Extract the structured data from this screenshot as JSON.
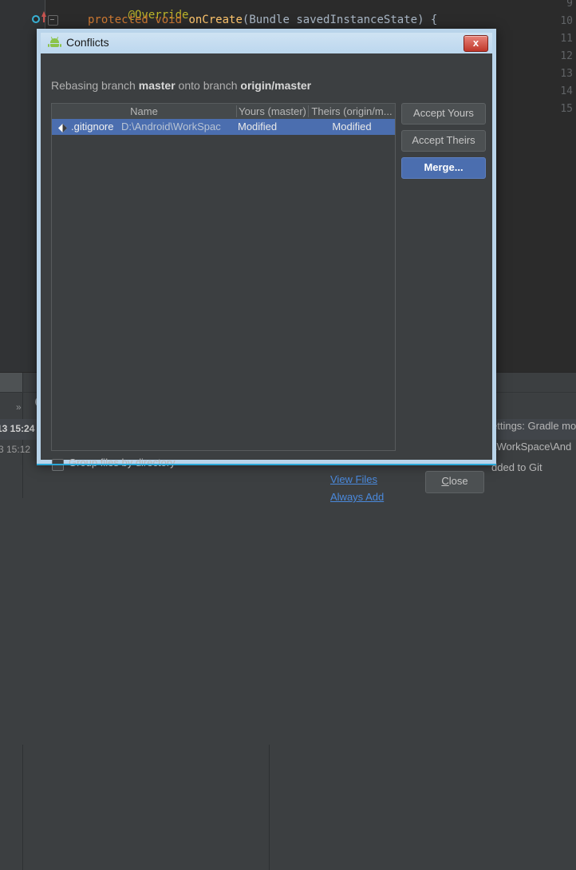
{
  "background": {
    "editor": {
      "line_numbers": [
        "9",
        "10",
        "11",
        "12",
        "13",
        "14",
        "15"
      ],
      "code": {
        "line9_annotation": "@Override",
        "line10_kw1": "protected",
        "line10_kw2": "void",
        "line10_fn": "onCreate",
        "line10_paren_open": "(",
        "line10_type": "Bundle",
        "line10_param": "savedInstanceState",
        "line10_tail": ") {"
      },
      "icons": {
        "breakpoint": "breakpoint-icon",
        "override_arrow": "override-marker-icon",
        "fold": "code-fold-icon"
      }
    },
    "tool_window": {
      "expand_icon": "»",
      "search_icon": "search-icon",
      "timestamps": [
        {
          "bold": "13 15:24",
          "normal": ""
        },
        {
          "bold": "",
          "normal": "3 15:12"
        }
      ],
      "log_lines": [
        "ettings: Gradle mo",
        "l\\WorkSpace\\And",
        "dded to Git"
      ],
      "links": [
        "View Files",
        "Always Add"
      ]
    }
  },
  "dialog": {
    "title": "Conflicts",
    "app_icon": "android-robot-icon",
    "close_x_label": "x",
    "message": {
      "prefix": "Rebasing branch ",
      "branch_yours": "master",
      "middle": " onto branch ",
      "branch_theirs": "origin/master"
    },
    "table": {
      "columns": [
        "Name",
        "Yours (master)",
        "Theirs (origin/m..."
      ],
      "rows": [
        {
          "icon": "git-file-icon",
          "name": ".gitignore",
          "path": "D:\\Android\\WorkSpac",
          "yours": "Modified",
          "theirs": "Modified",
          "selected": true
        }
      ]
    },
    "buttons": {
      "accept_yours": "Accept Yours",
      "accept_theirs": "Accept Theirs",
      "merge": "Merge...",
      "close_pre": "C",
      "close_post": "lose"
    },
    "group_checkbox": {
      "label": "Group files by directory",
      "checked": false
    }
  },
  "colors": {
    "accent": "#4b6eaf",
    "titlebar": "#cfe3f3",
    "dialog_bg": "#3c3f41",
    "editor_bg": "#2b2b2b",
    "link": "#4a89dc",
    "close_red": "#c0372b"
  }
}
